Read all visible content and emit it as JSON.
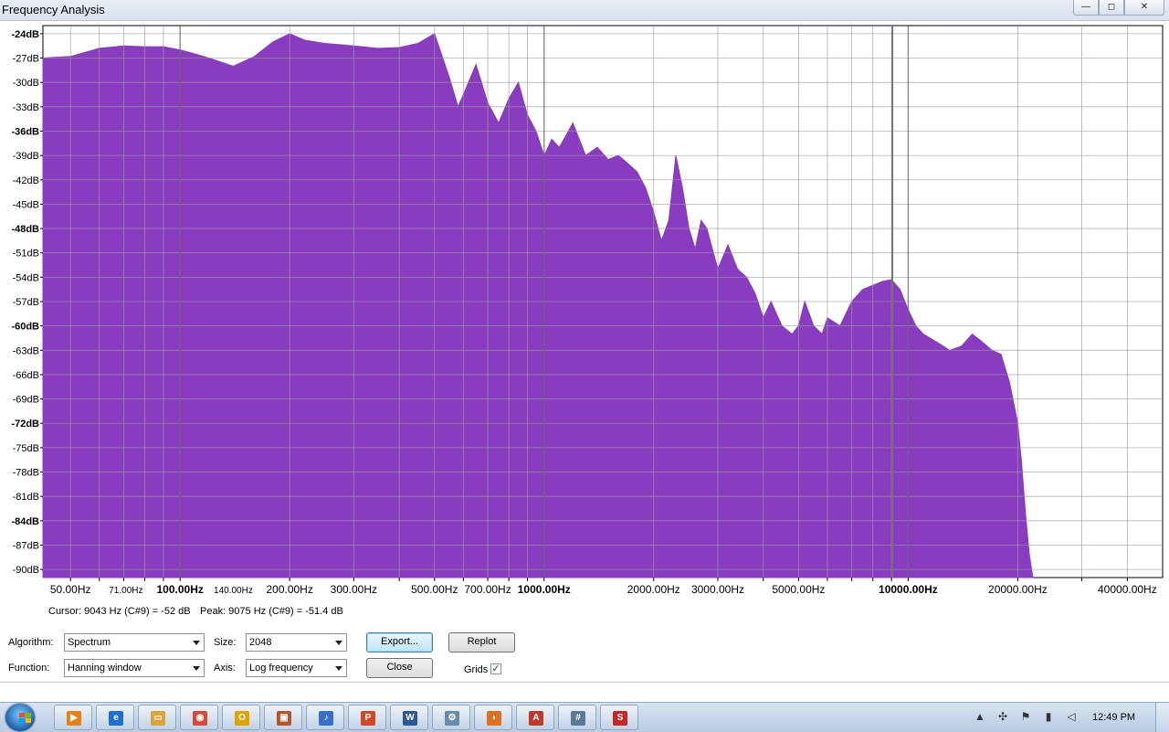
{
  "window": {
    "title": "Frequency Analysis",
    "minimize_label": "—",
    "maximize_label": "◻",
    "close_label": "✕"
  },
  "chart_data": {
    "type": "area",
    "xscale": "log",
    "xlim": [
      42,
      50000
    ],
    "ylim": [
      -91,
      -23
    ],
    "fill_color": "#8a3cc0",
    "grid": true,
    "y_ticks": [
      -24,
      -27,
      -30,
      -33,
      -36,
      -39,
      -42,
      -45,
      -48,
      -51,
      -54,
      -57,
      -60,
      -63,
      -66,
      -69,
      -72,
      -75,
      -78,
      -81,
      -84,
      -87,
      -90
    ],
    "y_tick_labels": [
      "-24dB",
      "-27dB",
      "-30dB",
      "-33dB",
      "-36dB",
      "-39dB",
      "-42dB",
      "-45dB",
      "-48dB",
      "-51dB",
      "-54dB",
      "-57dB",
      "-60dB",
      "-63dB",
      "-66dB",
      "-69dB",
      "-72dB",
      "-75dB",
      "-78dB",
      "-81dB",
      "-84dB",
      "-87dB",
      "-90dB"
    ],
    "x_ticks": [
      {
        "value": 50,
        "label": "50.00Hz",
        "bold": false
      },
      {
        "value": 71,
        "label": "71.00Hz",
        "bold": false
      },
      {
        "value": 100,
        "label": "100.00Hz",
        "bold": true
      },
      {
        "value": 140,
        "label": "140.00Hz",
        "bold": false
      },
      {
        "value": 200,
        "label": "200.00Hz",
        "bold": false
      },
      {
        "value": 300,
        "label": "300.00Hz",
        "bold": false
      },
      {
        "value": 500,
        "label": "500.00Hz",
        "bold": false
      },
      {
        "value": 700,
        "label": "700.00Hz",
        "bold": false
      },
      {
        "value": 1000,
        "label": "1000.00Hz",
        "bold": true
      },
      {
        "value": 2000,
        "label": "2000.00Hz",
        "bold": false
      },
      {
        "value": 3000,
        "label": "3000.00Hz",
        "bold": false
      },
      {
        "value": 5000,
        "label": "5000.00Hz",
        "bold": false
      },
      {
        "value": 10000,
        "label": "10000.00Hz",
        "bold": true
      },
      {
        "value": 20000,
        "label": "20000.00Hz",
        "bold": false
      },
      {
        "value": 40000,
        "label": "40000.00Hz",
        "bold": false
      }
    ],
    "x_grid": [
      50,
      60,
      70,
      80,
      90,
      100,
      200,
      300,
      400,
      500,
      600,
      700,
      800,
      900,
      1000,
      2000,
      3000,
      4000,
      5000,
      6000,
      7000,
      8000,
      9000,
      10000,
      20000,
      30000,
      40000
    ],
    "x_grid_bold": [
      100,
      1000,
      10000
    ],
    "cursor_freq": 9043,
    "peak_freq": 9075,
    "x": [
      42,
      50,
      60,
      70,
      80,
      90,
      100,
      110,
      120,
      140,
      160,
      180,
      200,
      220,
      250,
      300,
      350,
      400,
      450,
      500,
      550,
      580,
      600,
      650,
      700,
      750,
      800,
      850,
      900,
      950,
      1000,
      1050,
      1100,
      1150,
      1200,
      1300,
      1400,
      1500,
      1600,
      1700,
      1800,
      1900,
      2000,
      2100,
      2200,
      2300,
      2400,
      2500,
      2600,
      2700,
      2800,
      3000,
      3200,
      3400,
      3600,
      3800,
      4000,
      4200,
      4500,
      4800,
      5000,
      5200,
      5500,
      5800,
      6000,
      6500,
      7000,
      7500,
      8000,
      8500,
      9000,
      9500,
      10000,
      10500,
      11000,
      12000,
      13000,
      14000,
      15000,
      16000,
      17000,
      18000,
      19000,
      20000,
      20500,
      21000,
      21500,
      22000,
      22050
    ],
    "values": [
      -27,
      -26.8,
      -25.8,
      -25.5,
      -25.6,
      -25.6,
      -26,
      -26.5,
      -27,
      -28,
      -26.8,
      -25,
      -24,
      -24.8,
      -25.2,
      -25.5,
      -25.8,
      -25.7,
      -25.2,
      -24,
      -29.5,
      -33,
      -31.5,
      -27.8,
      -32.5,
      -35,
      -32,
      -30,
      -34,
      -36,
      -39,
      -37,
      -38,
      -36.5,
      -35,
      -39,
      -38,
      -39.5,
      -39,
      -40,
      -41,
      -43,
      -46,
      -49.5,
      -47,
      -39,
      -43,
      -48,
      -50.5,
      -47,
      -48,
      -53,
      -50,
      -53,
      -54,
      -56,
      -59,
      -57,
      -60,
      -61,
      -60,
      -57,
      -60,
      -61,
      -59,
      -60,
      -57,
      -55.5,
      -55,
      -54.5,
      -54.3,
      -55.5,
      -58,
      -60,
      -61,
      -62,
      -63,
      -62.5,
      -61,
      -62,
      -63,
      -63.5,
      -67,
      -72,
      -77,
      -83,
      -88,
      -91,
      -91
    ]
  },
  "status": {
    "cursor": "Cursor: 9043 Hz (C#9) = -52 dB",
    "peak": "Peak: 9075 Hz (C#9) = -51.4 dB"
  },
  "controls": {
    "algorithm_label": "Algorithm:",
    "algorithm_value": "Spectrum",
    "size_label": "Size:",
    "size_value": "2048",
    "export_label": "Export...",
    "replot_label": "Replot",
    "function_label": "Function:",
    "function_value": "Hanning window",
    "axis_label": "Axis:",
    "axis_value": "Log frequency",
    "close_label": "Close",
    "grids_label": "Grids",
    "grids_checked": "✓"
  },
  "taskbar": {
    "clock": "12:49 PM",
    "apps": [
      {
        "icon": "media-player-icon",
        "glyph": "▶",
        "color": "#e8801a"
      },
      {
        "icon": "internet-explorer-icon",
        "glyph": "e",
        "color": "#1f6fd0"
      },
      {
        "icon": "folder-icon",
        "glyph": "▭",
        "color": "#d9a43a"
      },
      {
        "icon": "chrome-icon",
        "glyph": "◉",
        "color": "#d64a3a"
      },
      {
        "icon": "outlook-icon",
        "glyph": "O",
        "color": "#e0a400"
      },
      {
        "icon": "remote-desktop-icon",
        "glyph": "▣",
        "color": "#b0582a"
      },
      {
        "icon": "itunes-icon",
        "glyph": "♪",
        "color": "#3a6fc9"
      },
      {
        "icon": "powerpoint-icon",
        "glyph": "P",
        "color": "#d24726"
      },
      {
        "icon": "word-icon",
        "glyph": "W",
        "color": "#2b5797"
      },
      {
        "icon": "tools-icon",
        "glyph": "⚙",
        "color": "#6a8aa8"
      },
      {
        "icon": "audacity-icon",
        "glyph": "◗",
        "color": "#e07020"
      },
      {
        "icon": "pdf-icon",
        "glyph": "A",
        "color": "#c0392b"
      },
      {
        "icon": "calculator-icon",
        "glyph": "#",
        "color": "#5a7a9a"
      },
      {
        "icon": "sbp-app-icon",
        "glyph": "S",
        "color": "#c62828"
      }
    ],
    "tray": [
      "chevron-up-icon",
      "network-app-icon",
      "flag-icon",
      "signal-icon",
      "volume-icon"
    ]
  }
}
